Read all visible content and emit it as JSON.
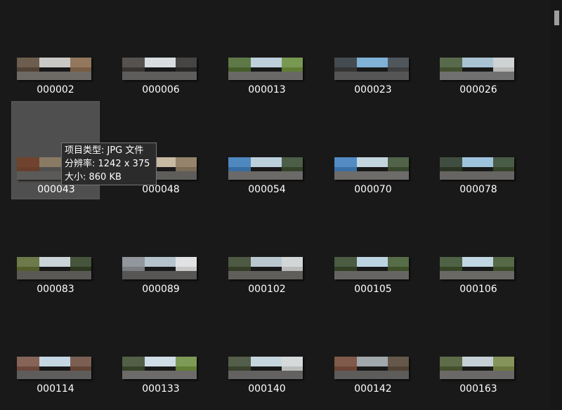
{
  "files": [
    {
      "name": "000002",
      "colors": {
        "sky": "#c9c8c4",
        "left": "#5c4a3a",
        "right": "#8a6a4c",
        "road": "#6d6a66"
      }
    },
    {
      "name": "000006",
      "colors": {
        "sky": "#d9dde0",
        "left": "#3e3a36",
        "right": "#2c2a28",
        "road": "#5e5d5b"
      }
    },
    {
      "name": "000013",
      "colors": {
        "sky": "#bdd0db",
        "left": "#4d6a2d",
        "right": "#6d8f3a",
        "road": "#6a6866"
      }
    },
    {
      "name": "000023",
      "colors": {
        "sky": "#7fb2d6",
        "left": "#3a3a3a",
        "right": "#464646",
        "road": "#555555"
      }
    },
    {
      "name": "000026",
      "colors": {
        "sky": "#a9c3d3",
        "left": "#4a5a34",
        "right": "#d5d5d2",
        "road": "#707070"
      }
    },
    {
      "name": "000043",
      "colors": {
        "sky": "#8a7a64",
        "left": "#6b3a26",
        "right": "#584a3e",
        "road": "#5c5a58"
      }
    },
    {
      "name": "000048",
      "colors": {
        "sky": "#c8b9a2",
        "left": "#5a4e40",
        "right": "#8c7a62",
        "road": "#5f5d5a"
      }
    },
    {
      "name": "000054",
      "colors": {
        "sky": "#bcd0dc",
        "left": "#3c7bb8",
        "right": "#3a4a2e",
        "road": "#6b6a68"
      }
    },
    {
      "name": "000070",
      "colors": {
        "sky": "#c3d5df",
        "left": "#3f7fbe",
        "right": "#3d5030",
        "road": "#6d6c6a"
      }
    },
    {
      "name": "000078",
      "colors": {
        "sky": "#9ec3dd",
        "left": "#2f3a26",
        "right": "#3a4a2c",
        "road": "#666563"
      }
    },
    {
      "name": "000083",
      "colors": {
        "sky": "#c9d3d8",
        "left": "#5e6a30",
        "right": "#2f3d20",
        "road": "#5a5956"
      }
    },
    {
      "name": "000089",
      "colors": {
        "sky": "#b5c3cc",
        "left": "#8c8f94",
        "right": "#e8e8e8",
        "road": "#575654"
      }
    },
    {
      "name": "000102",
      "colors": {
        "sky": "#b9c8cf",
        "left": "#3a4529",
        "right": "#d6d8d8",
        "road": "#605e5b"
      }
    },
    {
      "name": "000105",
      "colors": {
        "sky": "#bcd4e2",
        "left": "#374727",
        "right": "#445a2c",
        "road": "#666563"
      }
    },
    {
      "name": "000106",
      "colors": {
        "sky": "#c1d6e3",
        "left": "#3b4d29",
        "right": "#42562c",
        "road": "#6a6966"
      }
    },
    {
      "name": "000114",
      "colors": {
        "sky": "#c5d7e3",
        "left": "#7a5040",
        "right": "#6e4a3a",
        "road": "#5e5d5b"
      }
    },
    {
      "name": "000133",
      "colors": {
        "sky": "#cfdde6",
        "left": "#3c4a2c",
        "right": "#6e8f3c",
        "road": "#6c6b69"
      }
    },
    {
      "name": "000140",
      "colors": {
        "sky": "#c6d6df",
        "left": "#3e4a30",
        "right": "#d8dada",
        "road": "#636260"
      }
    },
    {
      "name": "000142",
      "colors": {
        "sky": "#a0a8ac",
        "left": "#7a4c3a",
        "right": "#5a4a3a",
        "road": "#5d5c5a"
      }
    },
    {
      "name": "000163",
      "colors": {
        "sky": "#c4d0d6",
        "left": "#4c5a30",
        "right": "#7a8a44",
        "road": "#6a6967"
      }
    }
  ],
  "selected_file": "000043",
  "tooltip": {
    "type_line": "项目类型: JPG 文件",
    "resolution_line": "分辨率: 1242 x 375",
    "size_line": "大小: 860 KB"
  },
  "colors": {
    "background": "#191919",
    "selection": "#4f4f4f",
    "scroll_thumb": "#9d9d9d"
  }
}
